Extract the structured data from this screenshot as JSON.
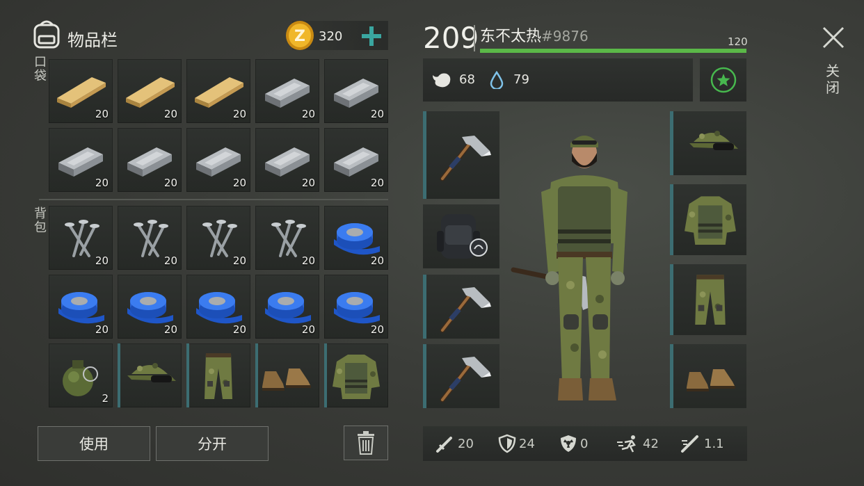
{
  "inventory": {
    "title": "物品栏",
    "coins": "320",
    "pocket_label": "口袋",
    "backpack_label": "背包",
    "pocket": [
      {
        "icon": "plank-icon",
        "count": "20"
      },
      {
        "icon": "plank-icon",
        "count": "20"
      },
      {
        "icon": "plank-icon",
        "count": "20"
      },
      {
        "icon": "iron-ingot-icon",
        "count": "20"
      },
      {
        "icon": "iron-ingot-icon",
        "count": "20"
      },
      {
        "icon": "iron-ingot-icon",
        "count": "20"
      },
      {
        "icon": "iron-ingot-icon",
        "count": "20"
      },
      {
        "icon": "iron-ingot-icon",
        "count": "20"
      },
      {
        "icon": "iron-ingot-icon",
        "count": "20"
      },
      {
        "icon": "iron-ingot-icon",
        "count": "20"
      }
    ],
    "backpack": [
      {
        "icon": "nails-icon",
        "count": "20"
      },
      {
        "icon": "nails-icon",
        "count": "20"
      },
      {
        "icon": "nails-icon",
        "count": "20"
      },
      {
        "icon": "nails-icon",
        "count": "20"
      },
      {
        "icon": "tape-icon",
        "count": "20"
      },
      {
        "icon": "tape-icon",
        "count": "20"
      },
      {
        "icon": "tape-icon",
        "count": "20"
      },
      {
        "icon": "tape-icon",
        "count": "20"
      },
      {
        "icon": "tape-icon",
        "count": "20"
      },
      {
        "icon": "tape-icon",
        "count": "20"
      },
      {
        "icon": "grenade-icon",
        "count": "2"
      },
      {
        "icon": "camo-cap-icon",
        "count": ""
      },
      {
        "icon": "camo-pants-icon",
        "count": ""
      },
      {
        "icon": "boots-icon",
        "count": ""
      },
      {
        "icon": "camo-vest-icon",
        "count": ""
      }
    ],
    "use_label": "使用",
    "split_label": "分开"
  },
  "player": {
    "level": "209",
    "name": "东不太热",
    "tag": "#9876",
    "health": "120",
    "hunger": "68",
    "thirst": "79"
  },
  "close_label": "关闭",
  "stats": [
    {
      "icon": "attack-icon",
      "value": "20"
    },
    {
      "icon": "defense-icon",
      "value": "24"
    },
    {
      "icon": "radiation-icon",
      "value": "0"
    },
    {
      "icon": "speed-icon",
      "value": "42"
    },
    {
      "icon": "attack-speed-icon",
      "value": "1.1"
    }
  ],
  "colors": {
    "health_bar": "#5bb848",
    "accent": "#3c6d72",
    "plus": "#3aa6a0"
  }
}
